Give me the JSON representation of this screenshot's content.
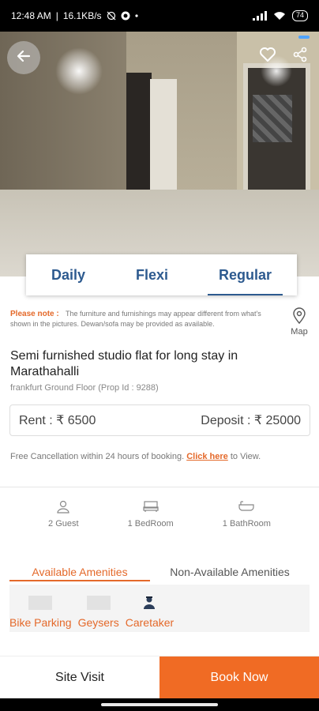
{
  "status_bar": {
    "time": "12:48 AM",
    "separator": "|",
    "speed": "16.1KB/s",
    "battery": "74"
  },
  "tabs": [
    {
      "label": "Daily",
      "active": false
    },
    {
      "label": "Flexi",
      "active": false
    },
    {
      "label": "Regular",
      "active": true
    }
  ],
  "note": {
    "label": "Please note :",
    "text": "The furniture and furnishings may appear different from what's shown in the pictures. Dewan/sofa may be provided as available."
  },
  "map_label": "Map",
  "listing": {
    "title": "Semi furnished studio flat for long stay in Marathahalli",
    "subtitle": "frankfurt Ground Floor (Prop Id : 9288)"
  },
  "pricing": {
    "rent": "Rent : ₹ 6500",
    "deposit": "Deposit : ₹ 25000"
  },
  "cancellation": {
    "text": "Free Cancellation within 24 hours of booking.",
    "link": "Click here",
    "suffix": "to View."
  },
  "features": [
    {
      "label": "2 Guest",
      "icon": "user-icon"
    },
    {
      "label": "1 BedRoom",
      "icon": "bed-icon"
    },
    {
      "label": "1 BathRoom",
      "icon": "bathtub-icon"
    }
  ],
  "amenity_tabs": {
    "available": "Available Amenities",
    "non_available": "Non-Available Amenities"
  },
  "amenities": [
    {
      "label": "Bike Parking"
    },
    {
      "label": "Geysers"
    },
    {
      "label": "Caretaker"
    }
  ],
  "actions": {
    "site_visit": "Site Visit",
    "book_now": "Book Now"
  },
  "colors": {
    "accent": "#f06b24",
    "tab_blue": "#2d5a8f"
  }
}
